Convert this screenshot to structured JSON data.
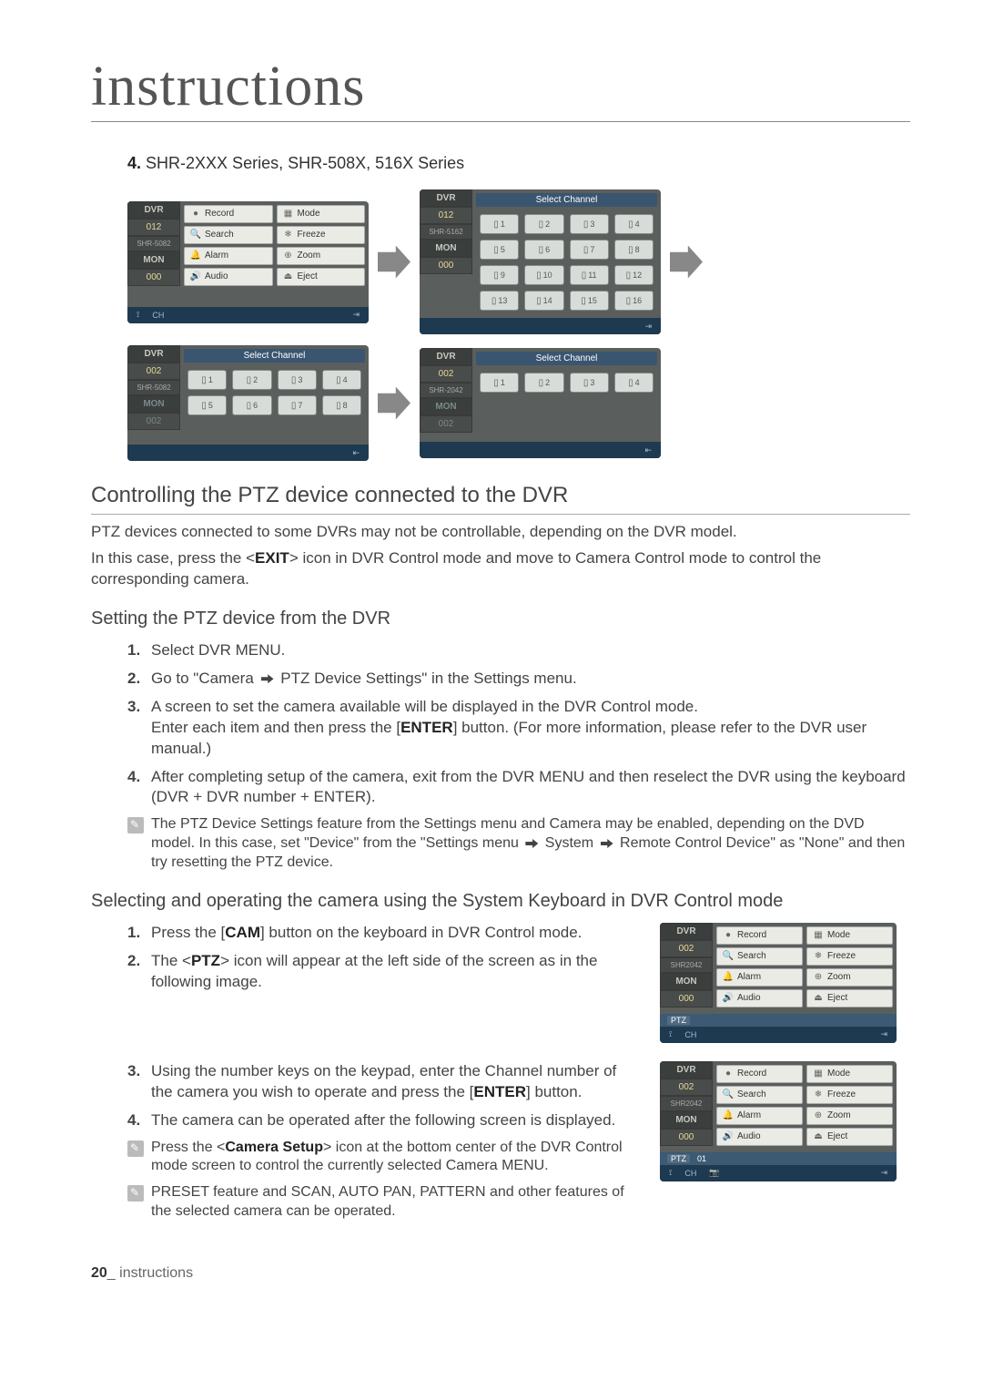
{
  "page_title": "instructions",
  "series_heading": {
    "num": "4.",
    "text": "SHR-2XXX Series, SHR-508X, 516X Series"
  },
  "dvr_labels": {
    "dvr": "DVR",
    "mon": "MON",
    "select_channel": "Select Channel"
  },
  "dvr_buttons": {
    "record": "Record",
    "mode": "Mode",
    "search": "Search",
    "freeze": "Freeze",
    "alarm": "Alarm",
    "zoom": "Zoom",
    "audio": "Audio",
    "eject": "Eject"
  },
  "screens": {
    "s1": {
      "dvr_val": "012",
      "model": "SHR-5082",
      "mon_val": "000"
    },
    "s2": {
      "dvr_val": "012",
      "model": "SHR-5162",
      "mon_val": "000",
      "channels": [
        "1",
        "2",
        "3",
        "4",
        "5",
        "6",
        "7",
        "8",
        "9",
        "10",
        "11",
        "12",
        "13",
        "14",
        "15",
        "16"
      ]
    },
    "s3": {
      "dvr_val": "002",
      "model": "SHR-5082",
      "mon_val": "002",
      "channels": [
        "1",
        "2",
        "3",
        "4",
        "5",
        "6",
        "7",
        "8"
      ]
    },
    "s4": {
      "dvr_val": "002",
      "model": "SHR-2042",
      "mon_val": "002",
      "channels": [
        "1",
        "2",
        "3",
        "4"
      ]
    },
    "s5": {
      "dvr_val": "002",
      "model": "SHR2042",
      "mon_val": "000",
      "ptz": "PTZ"
    },
    "s6": {
      "dvr_val": "002",
      "model": "SHR2042",
      "mon_val": "000",
      "ptz": "PTZ",
      "ptz_number": "01"
    }
  },
  "footer_ch": "CH",
  "h2_1": "Controlling the PTZ device connected to the DVR",
  "p1a": "PTZ devices connected to some DVRs may not be controllable, depending on the DVR model.",
  "p1b_pre": "In this case, press the <",
  "p1b_bold": "EXIT",
  "p1b_post": "> icon in DVR Control mode and move to Camera Control mode to control the corresponding camera.",
  "h3_1": "Setting the PTZ device from the DVR",
  "ol1": {
    "1": "Select DVR MENU.",
    "2_pre": "Go to \"Camera ",
    "2_post": " PTZ Device Settings\" in the Settings menu.",
    "3_a": "A screen to set the camera available will be displayed in the DVR Control mode.",
    "3_b_pre": "Enter each item and then press the [",
    "3_b_bold": "ENTER",
    "3_b_post": "] button. (For more information, please refer to the DVR user manual.)",
    "4": "After completing setup of the camera, exit from the DVR MENU and then reselect the DVR using the keyboard (DVR + DVR number + ENTER)."
  },
  "note1_pre": "The PTZ Device Settings feature from the Settings menu and Camera may be enabled,  depending on the DVD model. In this case, set \"Device\" from the \"Settings menu ",
  "note1_mid": " System ",
  "note1_post": " Remote Control Device\" as \"None\" and then try resetting the PTZ device.",
  "h3_2": "Selecting and operating the camera using the System Keyboard in DVR Control mode",
  "ol2": {
    "1_pre": "Press the [",
    "1_bold": "CAM",
    "1_post": "] button on the keyboard in DVR Control mode.",
    "2_pre": "The <",
    "2_bold": "PTZ",
    "2_post": "> icon will appear at the left side of the screen as in the following image.",
    "3_pre": "Using the number keys on the keypad, enter the Channel number of the camera you wish to operate and press the [",
    "3_bold": "ENTER",
    "3_post": "] button.",
    "4": "The camera can be operated after the following screen is displayed."
  },
  "note2_pre": "Press the <",
  "note2_bold": "Camera Setup",
  "note2_post": "> icon at the bottom center of the DVR Control mode screen to control the currently selected Camera MENU.",
  "note3": "PRESET feature and SCAN, AUTO PAN, PATTERN and other features of the selected camera can be operated.",
  "page_footer": {
    "num": "20",
    "sep": "_",
    "label": "instructions"
  }
}
